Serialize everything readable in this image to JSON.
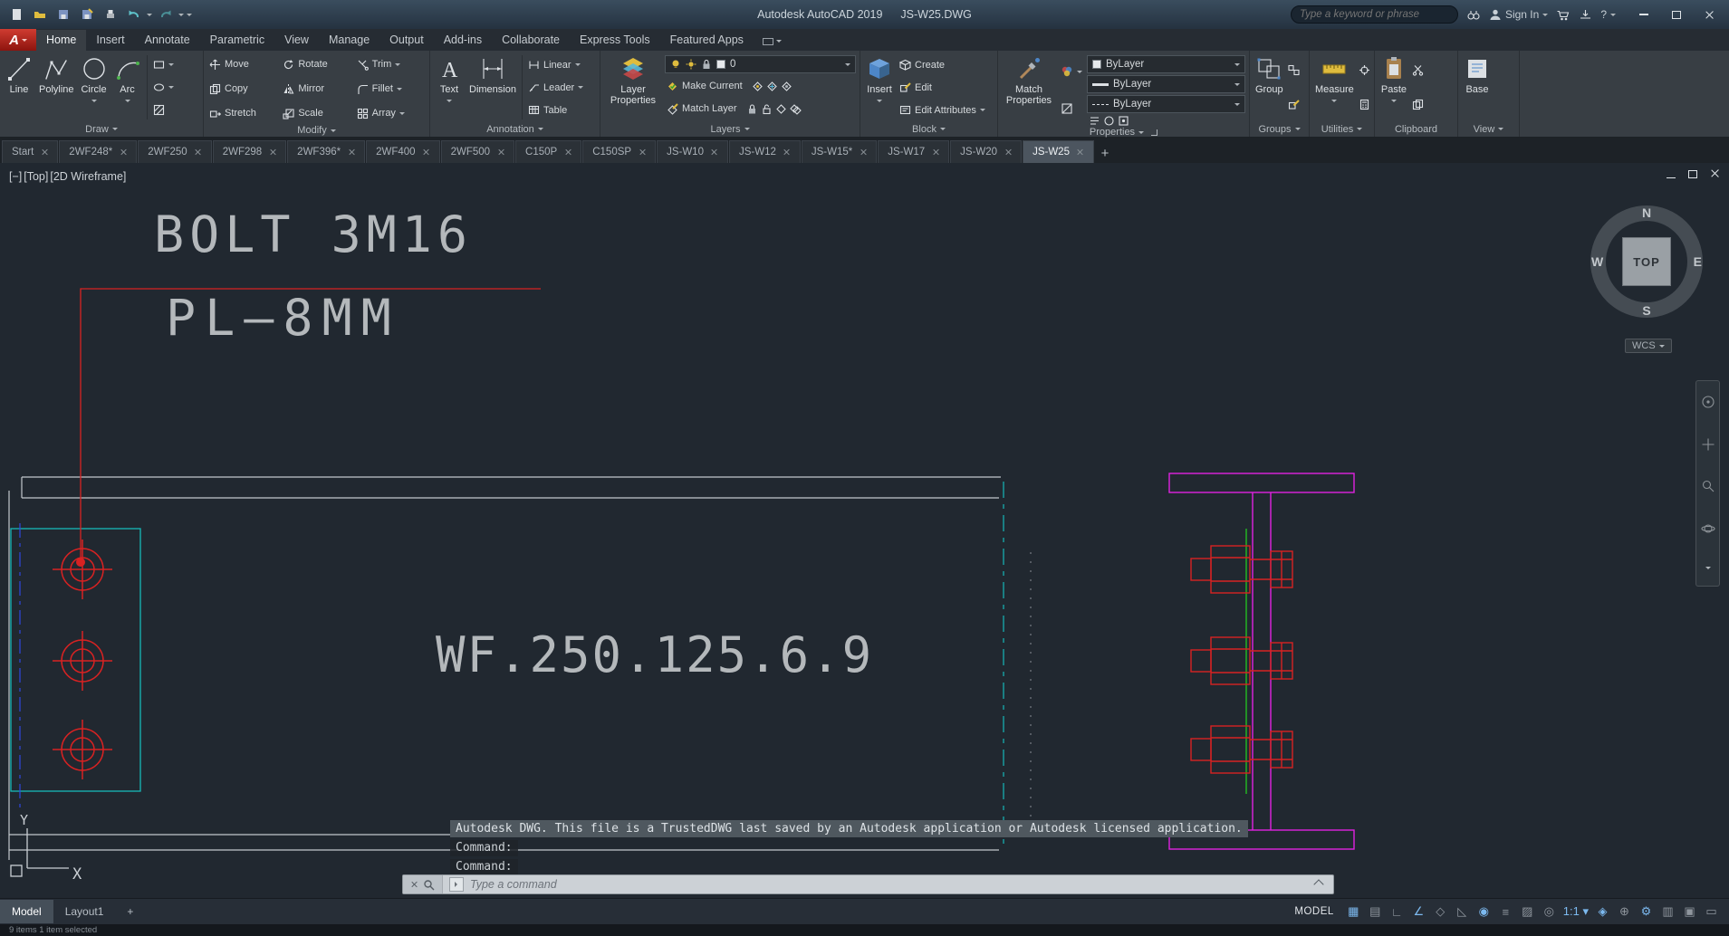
{
  "title_bar": {
    "app_title": "Autodesk AutoCAD 2019",
    "doc_title": "JS-W25.DWG",
    "search_placeholder": "Type a keyword or phrase",
    "sign_in_label": "Sign In",
    "help_label": "?"
  },
  "ribbon": {
    "tabs": [
      {
        "label": "Home",
        "active": true
      },
      {
        "label": "Insert"
      },
      {
        "label": "Annotate"
      },
      {
        "label": "Parametric"
      },
      {
        "label": "View"
      },
      {
        "label": "Manage"
      },
      {
        "label": "Output"
      },
      {
        "label": "Add-ins"
      },
      {
        "label": "Collaborate"
      },
      {
        "label": "Express Tools"
      },
      {
        "label": "Featured Apps"
      }
    ],
    "draw": {
      "label": "Draw",
      "line": "Line",
      "polyline": "Polyline",
      "circle": "Circle",
      "arc": "Arc"
    },
    "modify": {
      "label": "Modify",
      "move": "Move",
      "copy": "Copy",
      "stretch": "Stretch",
      "rotate": "Rotate",
      "mirror": "Mirror",
      "scale": "Scale",
      "trim": "Trim",
      "fillet": "Fillet",
      "array": "Array"
    },
    "annotation": {
      "label": "Annotation",
      "text": "Text",
      "dimension": "Dimension",
      "linear": "Linear",
      "leader": "Leader",
      "table": "Table"
    },
    "layers": {
      "label": "Layers",
      "layer_properties": "Layer Properties",
      "current_layer": "0",
      "make_current": "Make Current",
      "match_layer": "Match Layer"
    },
    "block": {
      "label": "Block",
      "insert": "Insert",
      "create": "Create",
      "edit": "Edit",
      "edit_attributes": "Edit Attributes"
    },
    "properties": {
      "label": "Properties",
      "match_properties": "Match Properties",
      "color_value": "ByLayer",
      "lineweight_value": "ByLayer",
      "linetype_value": "ByLayer"
    },
    "groups": {
      "label": "Groups",
      "group": "Group"
    },
    "utilities": {
      "label": "Utilities",
      "measure": "Measure"
    },
    "clipboard": {
      "label": "Clipboard",
      "paste": "Paste"
    },
    "view": {
      "label": "View",
      "base": "Base"
    }
  },
  "file_tabs": [
    {
      "label": "Start"
    },
    {
      "label": "2WF248*"
    },
    {
      "label": "2WF250"
    },
    {
      "label": "2WF298"
    },
    {
      "label": "2WF396*"
    },
    {
      "label": "2WF400"
    },
    {
      "label": "2WF500"
    },
    {
      "label": "C150P"
    },
    {
      "label": "C150SP"
    },
    {
      "label": "JS-W10"
    },
    {
      "label": "JS-W12"
    },
    {
      "label": "JS-W15*"
    },
    {
      "label": "JS-W17"
    },
    {
      "label": "JS-W20"
    },
    {
      "label": "JS-W25",
      "active": true
    }
  ],
  "viewport": {
    "minimize": "[−]",
    "view": "[Top]",
    "visual_style": "[2D Wireframe]"
  },
  "viewcube": {
    "north": "N",
    "south": "S",
    "east": "E",
    "west": "W",
    "face": "TOP",
    "wcs": "WCS"
  },
  "drawing": {
    "bolt_note": "BOLT 3M16",
    "plate_note": "PL—8MM",
    "beam_label": "WF.250.125.6.9",
    "ucs_x": "X",
    "ucs_y": "Y",
    "colors": {
      "background": "#212830",
      "geometry_gray": "#c3c8cc",
      "plate_cyan": "#17b8b8",
      "bolt_red": "#d82222",
      "beam_magenta": "#e022e0",
      "plate_edge_green": "#22c822",
      "centerline_blue": "#2f48e0",
      "cad_text": "#b4b8bb"
    }
  },
  "command_line": {
    "trust_message": "Autodesk DWG.  This file is a TrustedDWG last sa​ved by an Autodesk application or Autodesk licensed application.",
    "prompts": [
      "Command:",
      "Command:"
    ],
    "input_placeholder": "Type a command"
  },
  "status": {
    "model_tab": "Model",
    "layout_tab": "Layout1",
    "new_layout": "+",
    "model_space_label": "MODEL",
    "icons": [
      {
        "name": "grid",
        "glyph": "▦",
        "on": true
      },
      {
        "name": "snap-mode",
        "glyph": "▤",
        "on": false
      },
      {
        "name": "ortho",
        "glyph": "∟",
        "on": false
      },
      {
        "name": "polar-tracking",
        "glyph": "∠",
        "on": true
      },
      {
        "name": "isometric-drafting",
        "glyph": "◇",
        "on": false
      },
      {
        "name": "object-snap-tracking",
        "glyph": "◺",
        "on": false
      },
      {
        "name": "object-snap",
        "glyph": "◉",
        "on": true
      },
      {
        "name": "lineweight",
        "glyph": "≡",
        "on": false
      },
      {
        "name": "transparency",
        "glyph": "▨",
        "on": false
      },
      {
        "name": "selection-cycling",
        "glyph": "◎",
        "on": false
      },
      {
        "name": "annotation-scale",
        "glyph": "1:1 ▾",
        "on": true
      },
      {
        "name": "annotation-visibility",
        "glyph": "◈",
        "on": true
      },
      {
        "name": "autoscale",
        "glyph": "⊕",
        "on": false
      },
      {
        "name": "workspace-switching",
        "glyph": "⚙",
        "on": true
      },
      {
        "name": "quick-properties",
        "glyph": "▥",
        "on": false
      },
      {
        "name": "isolate-objects",
        "glyph": "▣",
        "on": false
      },
      {
        "name": "clean-screen",
        "glyph": "▭",
        "on": false
      }
    ]
  },
  "background_window": {
    "status_text": "9 items    1 item selected"
  }
}
